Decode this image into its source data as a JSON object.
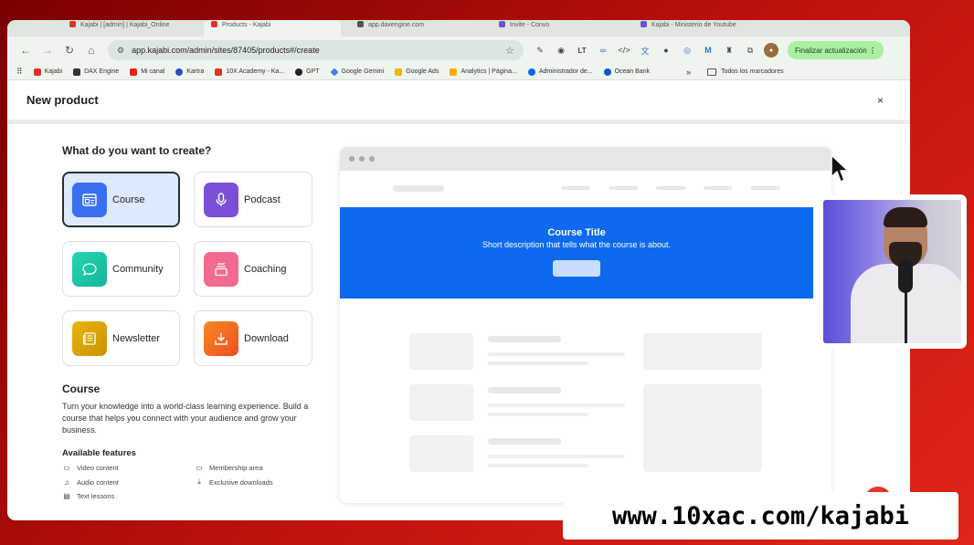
{
  "browser": {
    "tabs": [
      {
        "label": "Kajabi | [admin] | Kajabi_Online",
        "color": "#e0312b"
      },
      {
        "label": "Products - Kajabi",
        "color": "#e0312b"
      },
      {
        "label": "app.daxengine.com",
        "color": "#555555"
      },
      {
        "label": "Invite - Convo",
        "color": "#6b4fd8"
      },
      {
        "label": "Kajabi - Ministerio de Youtube",
        "color": "#6b4fd8"
      }
    ],
    "url": "app.kajabi.com/admin/sites/87405/products#/create",
    "update_button": "Finalizar actualización",
    "bookmarks": [
      {
        "label": "Kajabi",
        "color": "#e0312b"
      },
      {
        "label": "DAX Engine",
        "color": "#333333"
      },
      {
        "label": "Mi canal",
        "color": "#e62117"
      },
      {
        "label": "Kartra",
        "color": "#2b4dbf"
      },
      {
        "label": "10X Academy - Ka...",
        "color": "#e0312b"
      },
      {
        "label": "GPT",
        "color": "#222222"
      },
      {
        "label": "Google Gemini",
        "color": "#4a7bea"
      },
      {
        "label": "Google Ads",
        "color": "#f4b400"
      },
      {
        "label": "Analytics | Página...",
        "color": "#f9ab00"
      },
      {
        "label": "Administrador de...",
        "color": "#0866ff"
      },
      {
        "label": "Ocean Bank",
        "color": "#0a5bc4"
      }
    ],
    "bookmarks_overflow": "»",
    "all_bookmarks": "Todos los marcadores"
  },
  "modal": {
    "title": "New product",
    "close": "×",
    "question": "What do you want to create?",
    "options": [
      {
        "label": "Course",
        "icon": "course-icon",
        "color": "#3a6ff0",
        "selected": true
      },
      {
        "label": "Podcast",
        "icon": "microphone-icon",
        "color": "#7b4fd6",
        "selected": false
      },
      {
        "label": "Community",
        "icon": "chat-bubble-icon",
        "color": "#1fc7a3",
        "selected": false
      },
      {
        "label": "Coaching",
        "icon": "coaching-icon",
        "color": "#f26a8d",
        "selected": false
      },
      {
        "label": "Newsletter",
        "icon": "newsletter-icon",
        "color": "#d9a30a",
        "selected": false
      },
      {
        "label": "Download",
        "icon": "download-icon",
        "color": "#f26522",
        "selected": false
      }
    ],
    "section_title": "Course",
    "section_description": "Turn your knowledge into a world-class learning experience. Build a course that helps you connect with your audience and grow your business.",
    "features_title": "Available features",
    "features": [
      {
        "label": "Video content",
        "icon": "video-icon"
      },
      {
        "label": "Membership area",
        "icon": "membership-icon"
      },
      {
        "label": "Audio content",
        "icon": "audio-icon"
      },
      {
        "label": "Exclusive downloads",
        "icon": "download-icon"
      },
      {
        "label": "Text lessons",
        "icon": "document-icon"
      }
    ]
  },
  "preview": {
    "hero_title": "Course Title",
    "hero_description": "Short description that tells what the course is about.",
    "hero_color": "#0d6af0"
  },
  "watermark": "www.10xac.com/kajabi"
}
